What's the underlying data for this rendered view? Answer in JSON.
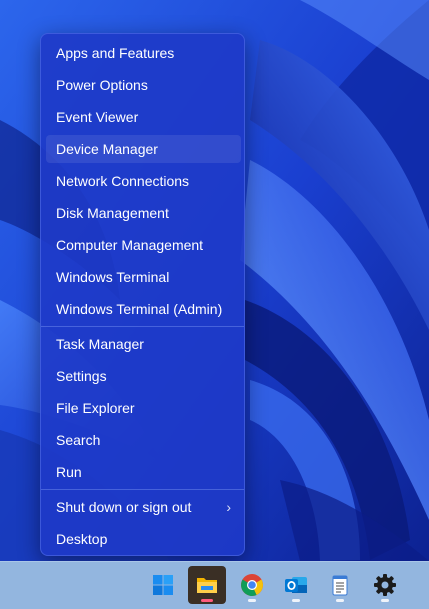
{
  "context_menu": {
    "groups": [
      [
        {
          "label": "Apps and Features"
        },
        {
          "label": "Power Options"
        },
        {
          "label": "Event Viewer"
        },
        {
          "label": "Device Manager"
        },
        {
          "label": "Network Connections"
        },
        {
          "label": "Disk Management"
        },
        {
          "label": "Computer Management"
        },
        {
          "label": "Windows Terminal"
        },
        {
          "label": "Windows Terminal (Admin)"
        }
      ],
      [
        {
          "label": "Task Manager"
        },
        {
          "label": "Settings"
        },
        {
          "label": "File Explorer"
        },
        {
          "label": "Search"
        },
        {
          "label": "Run"
        }
      ],
      [
        {
          "label": "Shut down or sign out",
          "submenu_indicator": "›"
        },
        {
          "label": "Desktop"
        }
      ]
    ],
    "hovered_item": "Device Manager"
  },
  "taskbar": {
    "items": [
      {
        "icon": "windows-start-icon",
        "active": false
      },
      {
        "icon": "file-explorer-icon",
        "active": true
      },
      {
        "icon": "chrome-icon",
        "active": false
      },
      {
        "icon": "outlook-icon",
        "active": false
      },
      {
        "icon": "notepad-icon",
        "active": false
      },
      {
        "icon": "settings-gear-icon",
        "active": false
      }
    ],
    "background_color": "#93b6df"
  },
  "colors": {
    "menu_background": "#1e3ac8",
    "menu_text": "#ffffff",
    "wallpaper_base": "#1a3fc7",
    "active_indicator": "#ff5a7d"
  }
}
